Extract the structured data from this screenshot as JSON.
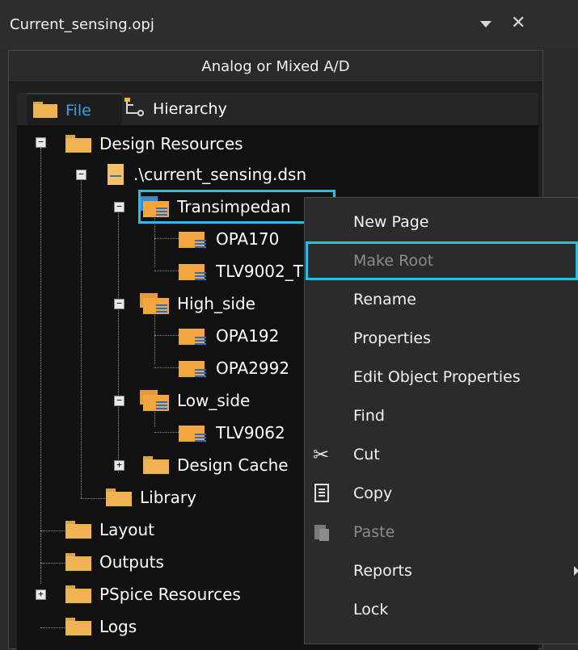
{
  "window": {
    "title": "Current_sensing.opj",
    "dropdown_icon": "chevron-down-icon",
    "close_icon": "close-icon",
    "close_glyph": "✕"
  },
  "modebar": {
    "label": "Analog or Mixed A/D"
  },
  "tabs": [
    {
      "label": "File",
      "icon": "folder-icon",
      "active": true
    },
    {
      "label": "Hierarchy",
      "icon": "hierarchy-icon",
      "active": false
    }
  ],
  "tree": {
    "design_resources": "Design Resources",
    "dsn_file": ".\\current_sensing.dsn",
    "transimpedance": "Transimpedan",
    "opa170": "OPA170",
    "tlv9002": "TLV9002_T",
    "high_side": "High_side",
    "opa192": "OPA192",
    "opa2992": "OPA2992",
    "low_side": "Low_side",
    "tlv9062": "TLV9062",
    "design_cache": "Design Cache",
    "library": "Library",
    "layout": "Layout",
    "outputs": "Outputs",
    "pspice": "PSpice Resources",
    "logs": "Logs",
    "expanded_glyph": "−",
    "collapsed_glyph": "+"
  },
  "context_menu": {
    "items": [
      {
        "label": "New Page",
        "enabled": true
      },
      {
        "label": "Make Root",
        "enabled": false
      },
      {
        "label": "Rename",
        "enabled": true
      },
      {
        "label": "Properties",
        "enabled": true
      },
      {
        "label": "Edit Object Properties",
        "enabled": true
      },
      {
        "label": "Find",
        "enabled": true
      },
      {
        "label": "Cut",
        "enabled": true,
        "icon": "scissors-icon"
      },
      {
        "label": "Copy",
        "enabled": true,
        "icon": "copy-icon"
      },
      {
        "label": "Paste",
        "enabled": false,
        "icon": "paste-icon"
      },
      {
        "label": "Reports",
        "enabled": true,
        "submenu": true
      },
      {
        "label": "Lock",
        "enabled": true
      }
    ],
    "cut_glyph": "✂"
  },
  "colors": {
    "highlight": "#2dbce6",
    "active_tab_text": "#31a6ea",
    "folder": "#f0b352",
    "menu_bg": "#2b2b2b"
  }
}
